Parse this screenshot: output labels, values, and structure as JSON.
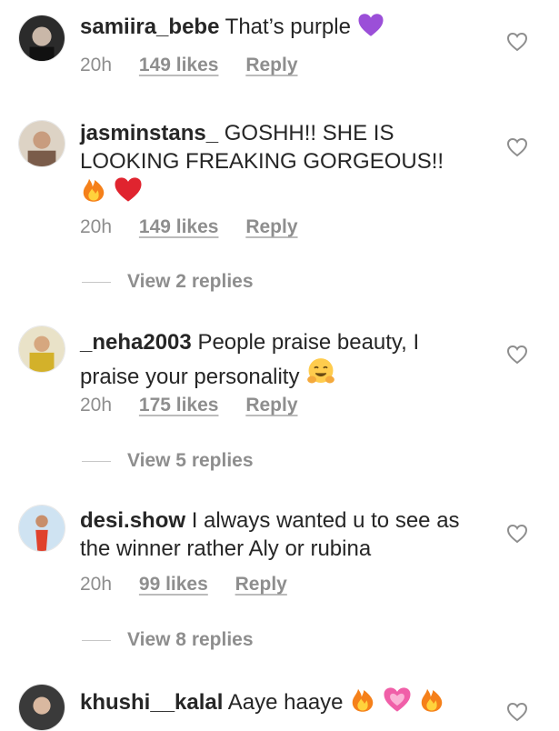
{
  "comments": [
    {
      "username": "samiira_bebe",
      "text": "That’s purple",
      "emojis": [
        "purple-heart"
      ],
      "time": "20h",
      "likes": "149 likes",
      "reply_label": "Reply"
    },
    {
      "username": "jasminstans_",
      "text": "GOSHH!! SHE IS LOOKING FREAKING GORGEOUS!!",
      "emojis": [
        "fire",
        "red-heart"
      ],
      "time": "20h",
      "likes": "149 likes",
      "reply_label": "Reply",
      "view_replies": "View 2 replies"
    },
    {
      "username": "_neha2003",
      "text": "People praise beauty, I praise your personality",
      "emojis": [
        "hugging-face"
      ],
      "time": "20h",
      "likes": "175 likes",
      "reply_label": "Reply",
      "view_replies": "View 5 replies"
    },
    {
      "username": "desi.show",
      "text": "I always wanted u to see as the winner rather Aly or rubina",
      "time": "20h",
      "likes": "99 likes",
      "reply_label": "Reply",
      "view_replies": "View 8 replies"
    },
    {
      "username": "khushi__kalal",
      "text": "Aaye haaye",
      "emojis": [
        "fire",
        "sparkling-heart",
        "fire"
      ]
    }
  ],
  "colors": {
    "text": "#262626",
    "secondary": "#8e8e8e",
    "divider": "#c7c7c7"
  }
}
